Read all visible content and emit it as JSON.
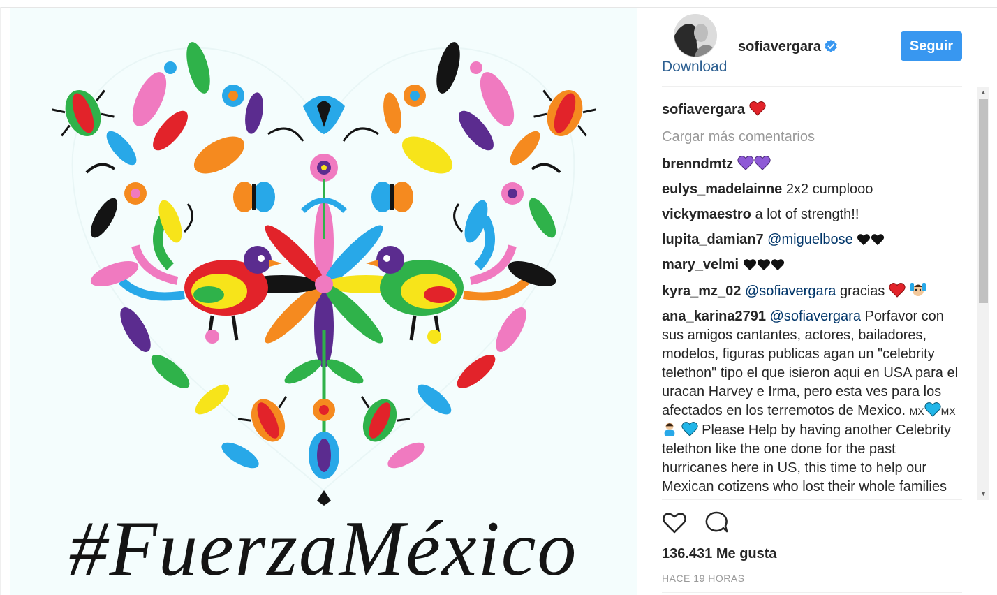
{
  "post": {
    "hashtag": "#FuerzaMéxico",
    "colors": {
      "background": "#f4fdfd",
      "pink": "#f07ac0",
      "orange": "#f58a1f",
      "yellow": "#f7e41a",
      "green": "#2fb24a",
      "blue": "#28a8e8",
      "purple": "#5b2c8f",
      "red": "#e2232a",
      "dark": "#141414"
    }
  },
  "header": {
    "username": "sofiavergara",
    "download_label": "Download",
    "follow_label": "Seguir",
    "verified": true
  },
  "comments": {
    "caption": {
      "user": "sofiavergara",
      "emoji": "red-heart"
    },
    "load_more": "Cargar más comentarios",
    "items": [
      {
        "user": "brenndmtz",
        "mention": "",
        "text": "",
        "emoji": "purple-heart x2"
      },
      {
        "user": "eulys_madelainne",
        "mention": "",
        "text": "2x2 cumplooo"
      },
      {
        "user": "vickymaestro",
        "mention": "",
        "text": "a lot of strength!!"
      },
      {
        "user": "lupita_damian7",
        "mention": "@miguelbose",
        "text": "",
        "emoji": "black-heart x2"
      },
      {
        "user": "mary_velmi",
        "mention": "",
        "text": "",
        "emoji": "black-heart x3"
      },
      {
        "user": "kyra_mz_02",
        "mention": "@sofiavergara",
        "text": "gracias",
        "emoji": "red-heart, raising-hands"
      },
      {
        "user": "ana_karina2791",
        "mention": "@sofiavergara",
        "text": "Porfavor con sus amigos cantantes, actores, bailadores, modelos, figuras publicas agan un \"celebrity telethon\" tipo el que isieron aqui en USA para el uracan Harvey e Irma, pero esta ves para los afectados en los terremotos de Mexico.",
        "flag_label": "MX",
        "text2": "Please Help by having another Celebrity telethon like the one done for the past hurricanes here in US, this time to help our Mexican cotizens who lost their whole families friends homes"
      }
    ]
  },
  "actions": {
    "likes_count": "136.431",
    "likes_label": "Me gusta",
    "timestamp": "HACE 19 HORAS",
    "icons": [
      "heart-outline-icon",
      "comment-bubble-icon"
    ]
  }
}
